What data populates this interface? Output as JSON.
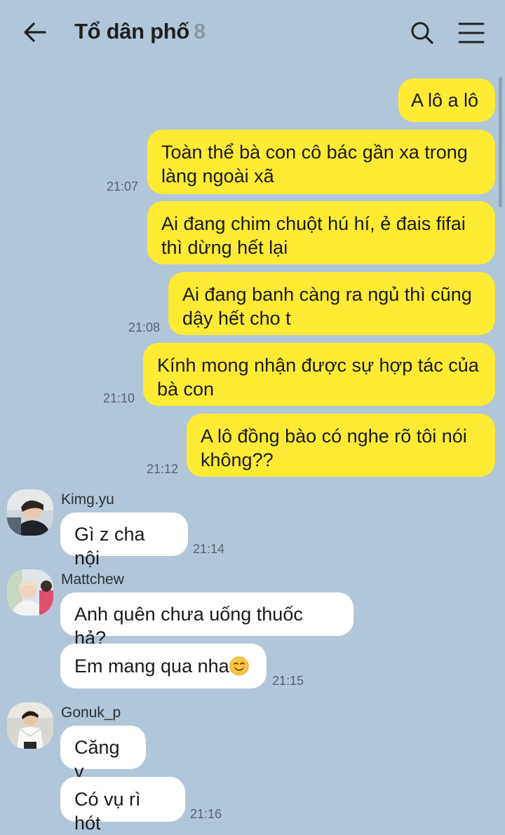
{
  "header": {
    "title": "Tổ dân phố",
    "member_count": "8",
    "back_icon": "arrow-left-icon",
    "search_icon": "search-icon",
    "menu_icon": "hamburger-menu-icon"
  },
  "colors": {
    "background": "#b1c6d8",
    "outgoing_bubble": "#ffeb34",
    "incoming_bubble": "#ffffff"
  },
  "outgoing": [
    {
      "text": "A lô a lô",
      "time": ""
    },
    {
      "text": "Toàn thể bà con cô bác gần xa trong làng ngoài xã",
      "time": "21:07"
    },
    {
      "text": "Ai đang chim chuột hú hí, ẻ đais fifai thì dừng hết lại",
      "time": ""
    },
    {
      "text": "Ai đang banh càng ra ngủ thì cũng dậy hết cho t",
      "time": "21:08"
    },
    {
      "text": "Kính mong nhận được sự hợp tác của bà con",
      "time": "21:10"
    },
    {
      "text": "A lô đồng bào có nghe rõ tôi nói không??",
      "time": "21:12"
    }
  ],
  "incoming": [
    {
      "sender": "Kimg.yu",
      "avatar_icon": "user-avatar",
      "messages": [
        {
          "text": "Gì z cha nội",
          "time": "21:14"
        }
      ]
    },
    {
      "sender": "Mattchew",
      "avatar_icon": "user-avatar",
      "messages": [
        {
          "text": "Anh quên chưa uống thuốc hả?",
          "time": ""
        },
        {
          "text": "Em mang qua nha",
          "emoji": "smiling-face-icon",
          "time": "21:15"
        }
      ]
    },
    {
      "sender": "Gonuk_p",
      "avatar_icon": "user-avatar",
      "messages": [
        {
          "text": "Căng v",
          "time": ""
        },
        {
          "text": "Có vụ rì hót",
          "time": "21:16"
        }
      ]
    }
  ]
}
